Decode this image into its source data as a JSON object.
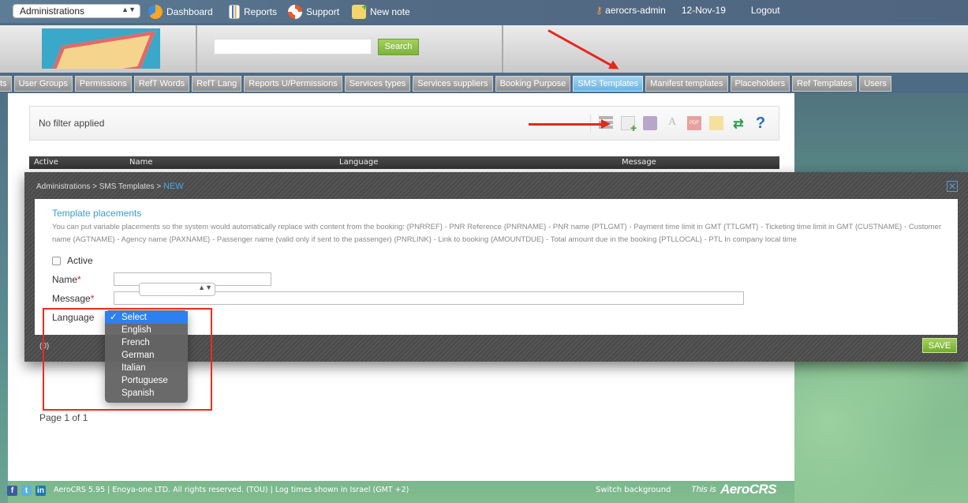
{
  "topbar": {
    "module_select": "Administrations",
    "nav": [
      {
        "label": "Dashboard",
        "icon": "dashboard-icon"
      },
      {
        "label": "Reports",
        "icon": "reports-icon"
      },
      {
        "label": "Support",
        "icon": "support-icon"
      },
      {
        "label": "New note",
        "icon": "new-note-icon"
      }
    ],
    "user": "aerocrs-admin",
    "date": "12-Nov-19",
    "logout": "Logout"
  },
  "header": {
    "search_placeholder": "",
    "search_button": "Search"
  },
  "tabs": [
    {
      "label": "ts",
      "active": false
    },
    {
      "label": "User Groups",
      "active": false
    },
    {
      "label": "Permissions",
      "active": false
    },
    {
      "label": "RefT Words",
      "active": false
    },
    {
      "label": "RefT Lang",
      "active": false
    },
    {
      "label": "Reports U/Permissions",
      "active": false
    },
    {
      "label": "Services types",
      "active": false
    },
    {
      "label": "Services suppliers",
      "active": false
    },
    {
      "label": "Booking Purpose",
      "active": false
    },
    {
      "label": "SMS Templates",
      "active": true
    },
    {
      "label": "Manifest templates",
      "active": false
    },
    {
      "label": "Placeholders",
      "active": false
    },
    {
      "label": "Ref Templates",
      "active": false
    },
    {
      "label": "Users",
      "active": false
    }
  ],
  "main": {
    "filter_text": "No filter applied",
    "toolbar": [
      "columns-icon",
      "add-new-icon",
      "print-icon",
      "font-icon",
      "pdf-icon",
      "email-icon",
      "refresh-icon",
      "help-icon"
    ],
    "grid_columns": [
      "Active",
      "Name",
      "Language",
      "Message"
    ],
    "page_info": "Page 1 of 1"
  },
  "modal": {
    "breadcrumb": "Administrations > SMS Templates > ",
    "breadcrumb_current": "NEW",
    "section_title": "Template placements",
    "description": "You can put variable placements so the system would automatically replace with content from the booking: {PNRREF} - PNR Reference {PNRNAME} - PNR name {PTLGMT} - Payment time limit in GMT {TTLGMT} - Ticketing time limit in GMT {CUSTNAME} - Customer name {AGTNAME} - Agency name {PAXNAME} - Passenger name (valid only if sent to the passenger) {PNRLINK} - Link to booking {AMOUNTDUE} - Total amount due in the booking {PTLLOCAL} - PTL In company local time",
    "active_label": "Active",
    "active_checked": false,
    "name_label": "Name",
    "name_value": "",
    "message_label": "Message",
    "message_value": "",
    "required_mark": "*",
    "language_label": "Language",
    "language_selected": "Select",
    "language_options": [
      "Select",
      "English",
      "French",
      "German",
      "Italian",
      "Portuguese",
      "Spanish"
    ],
    "count": "(0)",
    "save_label": "SAVE",
    "close_label": "✕"
  },
  "footer": {
    "text": "AeroCRS 5.95  | Enoya-one LTD. All rights reserved. (TOU)  | Log times shown in Israel (GMT +2)",
    "switch_background": "Switch background",
    "this_is": "This is",
    "brand": "AeroCRS"
  }
}
